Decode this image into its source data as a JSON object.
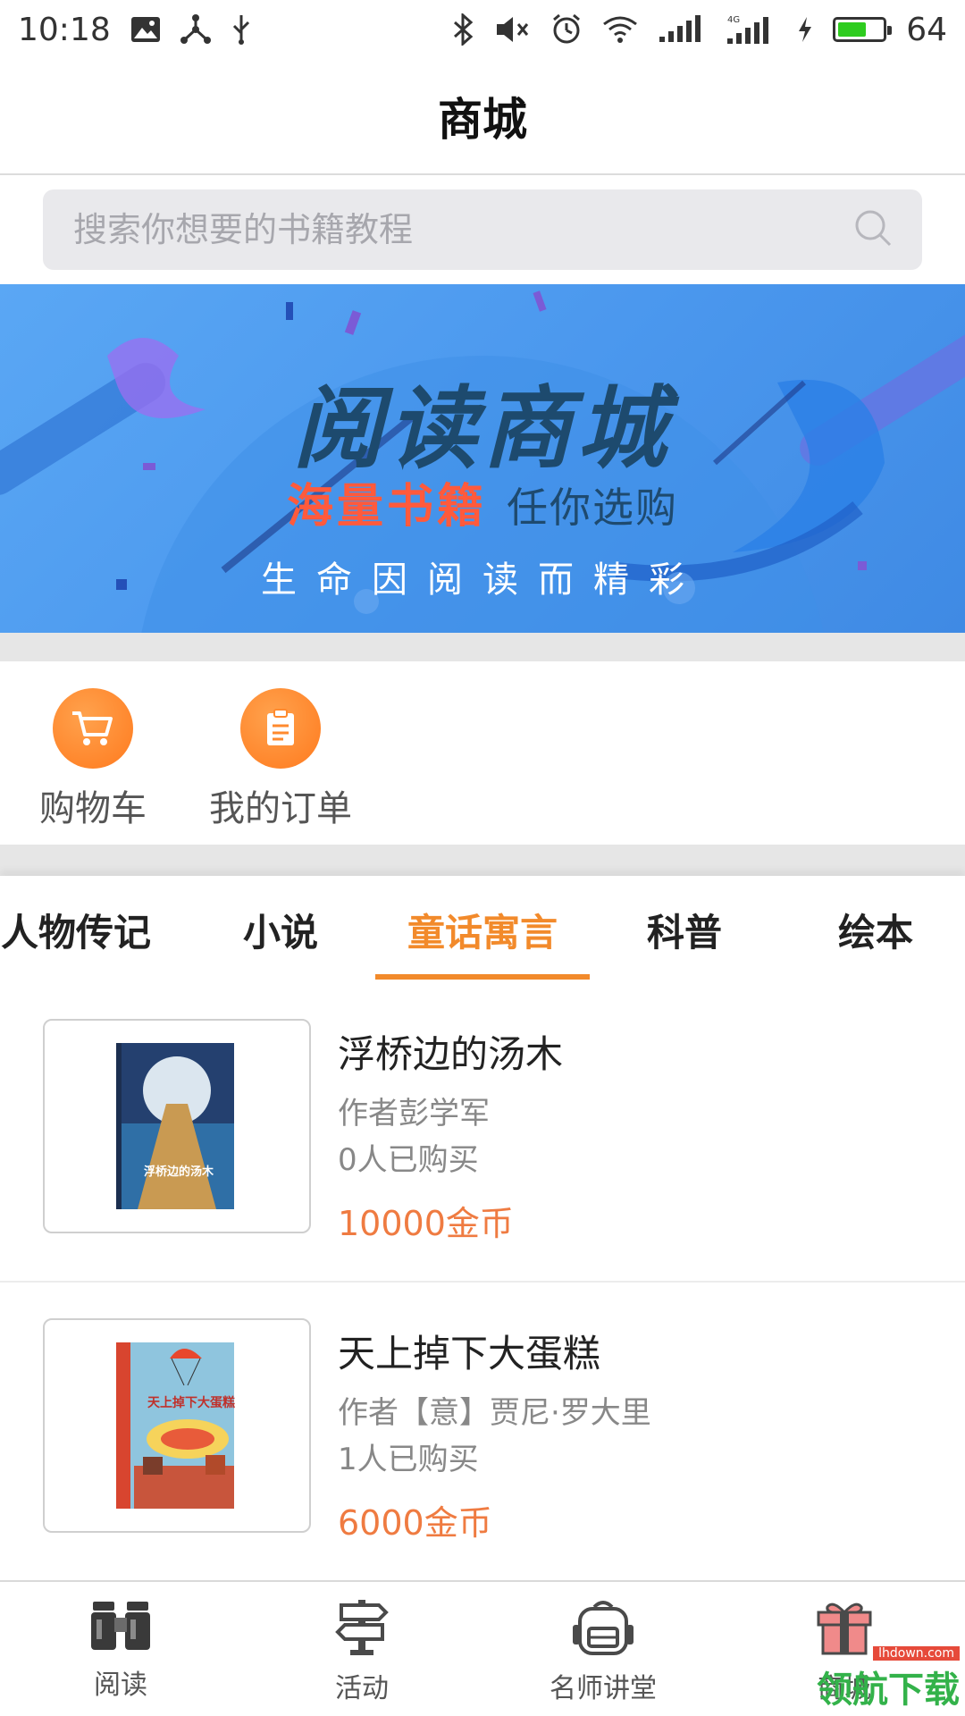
{
  "status_bar": {
    "time": "10:18",
    "battery": "64",
    "battery_level": 0.64,
    "network": "4G"
  },
  "header": {
    "title": "商城"
  },
  "search": {
    "placeholder": "搜索你想要的书籍教程"
  },
  "banner": {
    "title": "阅读商城",
    "sub_highlight": "海量书籍",
    "sub_rest": "任你选购",
    "tagline": "生命因阅读而精彩"
  },
  "quick_actions": [
    {
      "label": "购物车",
      "icon": "cart-icon"
    },
    {
      "label": "我的订单",
      "icon": "order-icon"
    }
  ],
  "tabs": [
    {
      "label": "人物传记",
      "active": false
    },
    {
      "label": "小说",
      "active": false
    },
    {
      "label": "童话寓言",
      "active": true
    },
    {
      "label": "科普",
      "active": false
    },
    {
      "label": "绘本",
      "active": false
    }
  ],
  "books": [
    {
      "title": "浮桥边的汤木",
      "author": "作者彭学军",
      "bought": "0人已购买",
      "price": "10000金币",
      "cover_text": "浮桥边的汤木"
    },
    {
      "title": "天上掉下大蛋糕",
      "author": "作者【意】贾尼·罗大里",
      "bought": "1人已购买",
      "price": "6000金币",
      "cover_text": "天上掉下大蛋糕"
    }
  ],
  "bottom_nav": [
    {
      "label": "阅读",
      "icon": "binoculars-icon"
    },
    {
      "label": "活动",
      "icon": "signpost-icon"
    },
    {
      "label": "名师讲堂",
      "icon": "backpack-icon"
    },
    {
      "label": "商城",
      "icon": "gift-icon"
    }
  ],
  "watermark": {
    "small": "lhdown.com",
    "big": "领航下载"
  },
  "colors": {
    "accent": "#f28a2b",
    "price": "#ef7b41",
    "banner": "#4b98ee"
  }
}
